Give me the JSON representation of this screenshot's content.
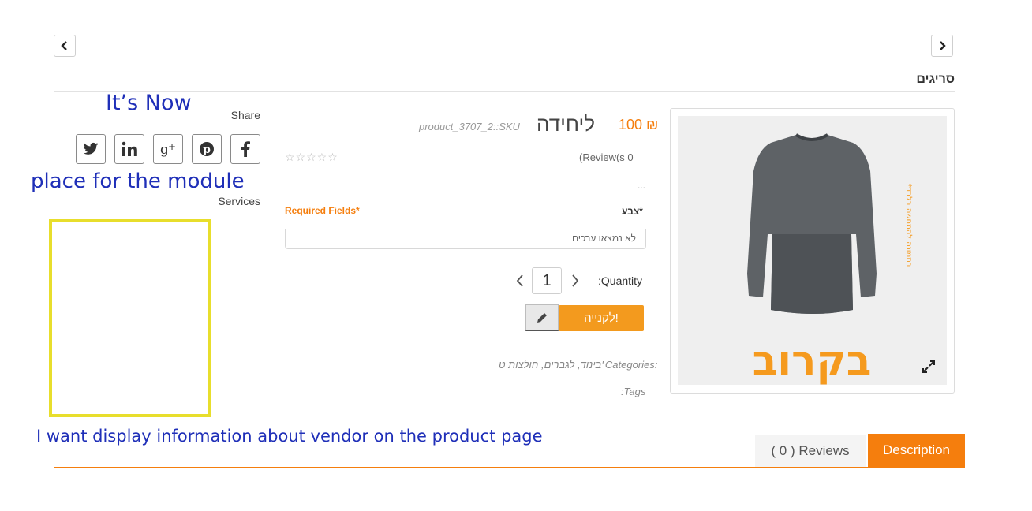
{
  "nav": {
    "prev_label": "‹",
    "next_label": "›"
  },
  "category_title": "סריגים",
  "annotations": {
    "its_now": "It’s Now",
    "place_for_module": "place for the module",
    "vendor_info": "I want display information about vendor on the product page"
  },
  "share": {
    "label": "Share",
    "services_label": "Services",
    "buttons": [
      "twitter",
      "linkedin",
      "google-plus",
      "pinterest",
      "facebook"
    ]
  },
  "product": {
    "price": "100 ₪",
    "price_unit": "ליחידה",
    "sku": "product_3707_2::SKU",
    "reviews_text": "(Review(s 0",
    "ellipsis": "...",
    "required_fields": "Required Fields*",
    "color_label": "צבע*",
    "color_select_value": "לא נמצאו ערכים",
    "quantity_label": ":Quantity",
    "quantity_value": "1",
    "buy_label": "לקנייה!",
    "categories_label": "Categories:",
    "categories_value": "בינוד, לגברים, חולצות ט'",
    "tags_label": ":Tags",
    "image_overlay_text": "בקרוב",
    "image_side_text": "*בתמונה להמחשה בלבד"
  },
  "tabs": {
    "description": "Description",
    "reviews": "( 0 ) Reviews"
  },
  "colors": {
    "accent": "#f57e0d",
    "annotation": "#1f2fb8",
    "module_box": "#e8de2c"
  }
}
